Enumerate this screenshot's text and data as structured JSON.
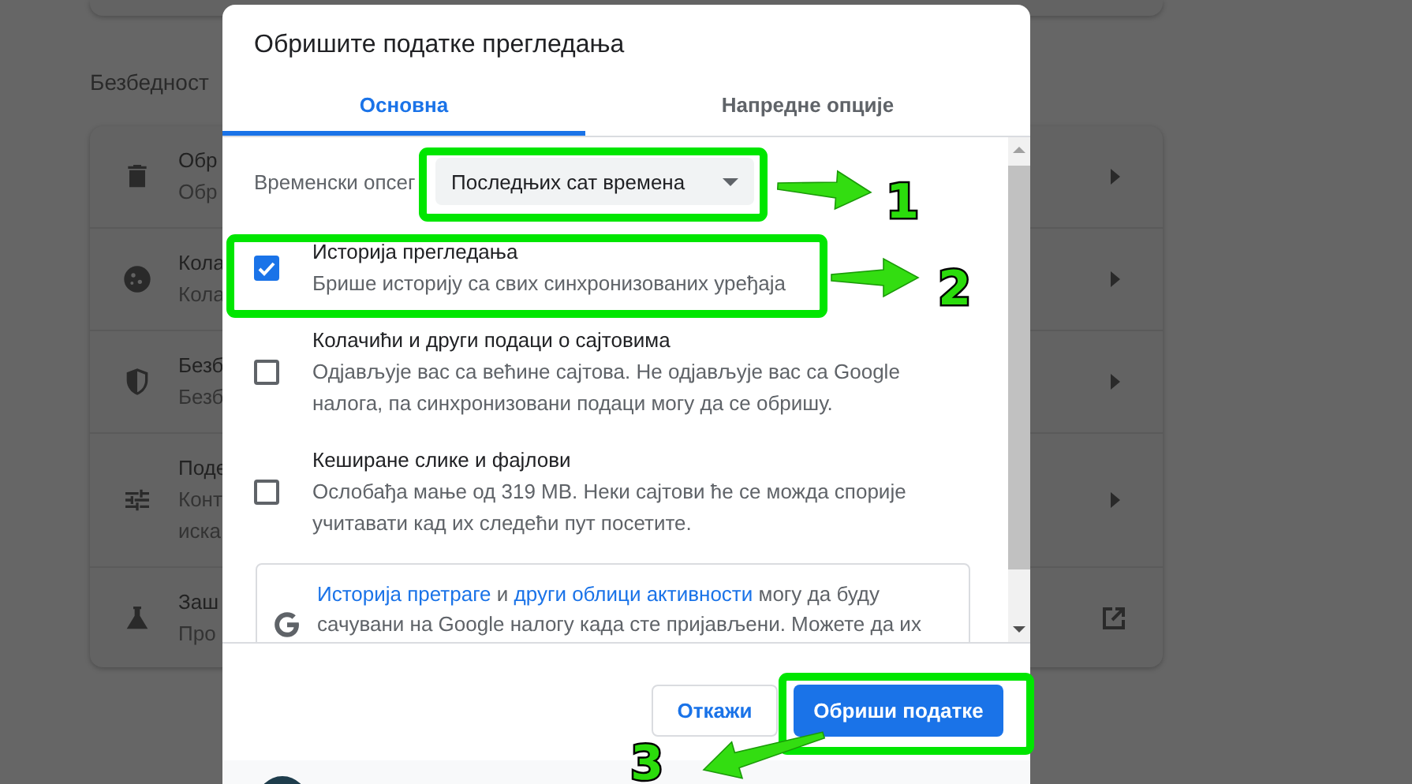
{
  "settings": {
    "section_title": "Безбедност",
    "rows": [
      {
        "kind": "submenu",
        "title": "Обр",
        "lines": [
          "Обр"
        ]
      },
      {
        "kind": "submenu",
        "title": "Кола",
        "lines": [
          "Кола"
        ]
      },
      {
        "kind": "submenu",
        "title": "Безб",
        "lines": [
          "Безб"
        ]
      },
      {
        "kind": "submenu",
        "title": "Поде",
        "lines": [
          "Конт",
          "иска"
        ]
      },
      {
        "kind": "external",
        "title": "Заш",
        "lines": [
          "Про"
        ]
      }
    ]
  },
  "dialog": {
    "title": "Обришите податке прегледања",
    "tabs": [
      {
        "label": "Основна",
        "selected": true
      },
      {
        "label": "Напредне опције",
        "selected": false
      }
    ],
    "time_range": {
      "label": "Временски опсег",
      "value": "Последњих сат времена"
    },
    "options": [
      {
        "title": "Историја прегледања",
        "description": "Брише историју са свих синхронизованих уређаја",
        "checked": true
      },
      {
        "title": "Колачићи и други подаци о сајтовима",
        "description": "Одјављује вас са већине сајтова. Не одјављује вас са Google налога, па синхронизовани подаци могу да се обришу.",
        "checked": false
      },
      {
        "title": "Кеширане слике и фајлови",
        "description": "Ослобађа мање од 319 MB. Неки сајтови ће се можда спорије учитавати кад их следећи пут посетите.",
        "checked": false
      }
    ],
    "notice": [
      {
        "text": "Историја претраге",
        "link": true
      },
      {
        "text": " и ",
        "link": false
      },
      {
        "text": "други облици активности",
        "link": true
      },
      {
        "text": " могу да буду сачувани на Google налогу када сте пријављени. Можете да их",
        "link": false
      }
    ],
    "buttons": [
      {
        "label": "Откажи",
        "kind": "secondary"
      },
      {
        "label": "Обриши податке",
        "kind": "primary"
      }
    ]
  },
  "annotations": [
    {
      "number": "1"
    },
    {
      "number": "2"
    },
    {
      "number": "3"
    }
  ]
}
